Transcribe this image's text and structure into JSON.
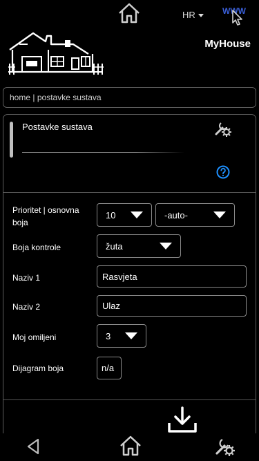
{
  "header": {
    "language": "HR",
    "app_title": "MyHouse",
    "www_label": "WWW"
  },
  "breadcrumb": {
    "home": "home",
    "separator": "|",
    "current": "postavke sustava"
  },
  "panel": {
    "title": "Postavke sustava"
  },
  "form": {
    "priority": {
      "label": "Prioritet | osnovna boja",
      "value": "10",
      "secondary_value": "-auto-"
    },
    "control_color": {
      "label": "Boja kontrole",
      "value": "žuta"
    },
    "name1": {
      "label": "Naziv 1",
      "value": "Rasvjeta"
    },
    "name2": {
      "label": "Naziv 2",
      "value": "Ulaz"
    },
    "favorites": {
      "label": "Moj omiljeni",
      "value": "3"
    },
    "color_diagram": {
      "label": "Dijagram boja",
      "value": "n/a"
    }
  },
  "icons": {
    "top_home": "home-icon",
    "www": "www-icon",
    "logo": "house-logo",
    "tools": "tools-icon",
    "help": "help-icon",
    "download": "download-icon",
    "back": "back-arrow-icon",
    "bottom_home": "home-icon"
  },
  "colors": {
    "background": "#000000",
    "border": "#5e5e5e",
    "help_blue": "#1e90ff",
    "www_blue": "#3a5fd9"
  }
}
